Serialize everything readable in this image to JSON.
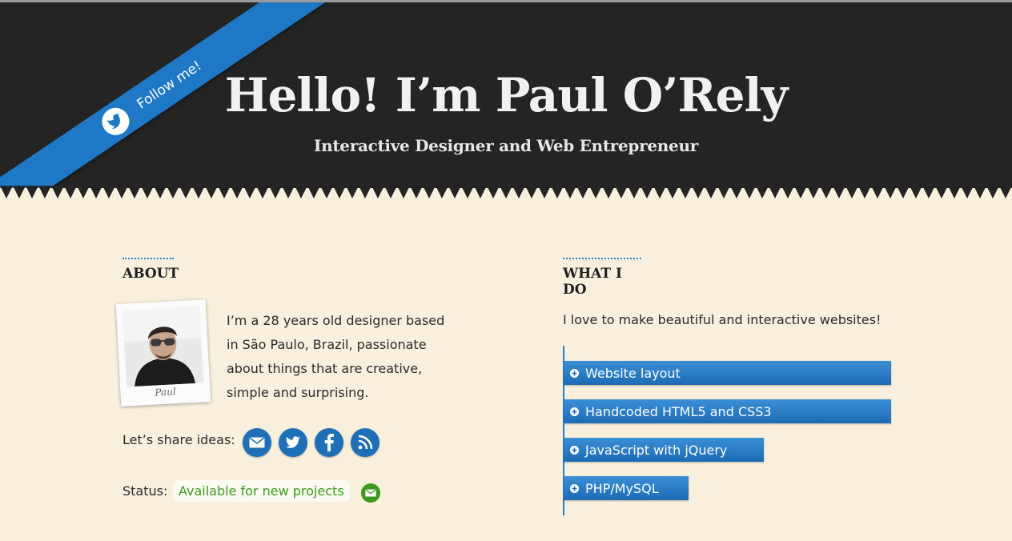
{
  "header": {
    "title": "Hello! I’m Paul O’Rely",
    "subtitle": "Interactive Designer and Web Entrepreneur"
  },
  "ribbon": {
    "label": "Follow me!",
    "icon": "twitter-bird-icon"
  },
  "about": {
    "heading": "ABOUT",
    "photo_caption": "Paul",
    "bio_lines": [
      "I’m a 28 years old designer based",
      "in São Paulo, Brazil, passionate",
      "about things that are creative,",
      "simple and surprising."
    ],
    "share_label": "Let’s share ideas:",
    "share_icons": [
      "email-icon",
      "twitter-icon",
      "facebook-icon",
      "rss-icon"
    ],
    "status_label": "Status:",
    "status_value": "Available for new projects",
    "status_icon": "email-icon"
  },
  "what_i_do": {
    "heading": "WHAT I DO",
    "intro": "I love to make beautiful and interactive websites!",
    "skills": [
      "Website layout",
      "Handcoded HTML5 and CSS3",
      "JavaScript with jQuery",
      "PHP/MySQL"
    ]
  },
  "colors": {
    "header_bg": "#242424",
    "page_bg": "#f8f0dc",
    "accent_blue": "#1f78c6",
    "status_green": "#3a9a1c"
  }
}
